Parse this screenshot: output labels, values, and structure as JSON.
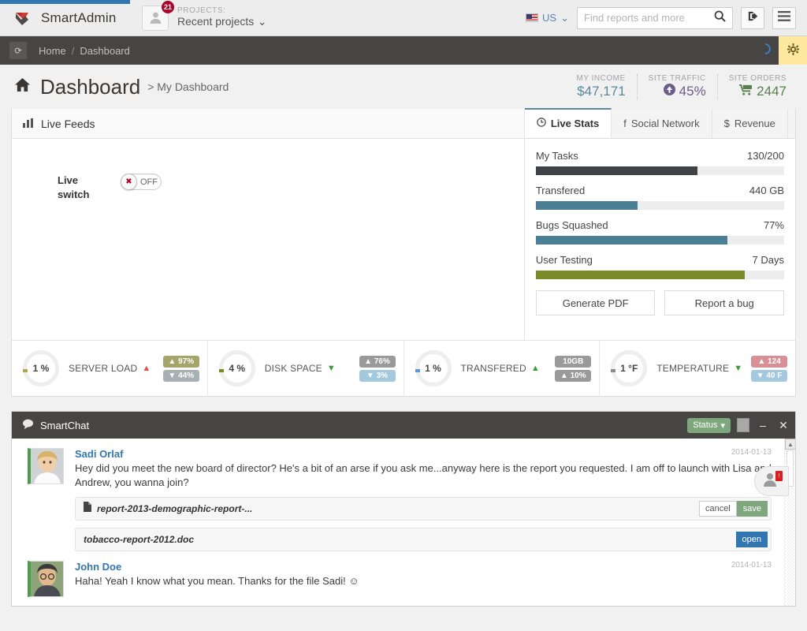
{
  "brand": {
    "name": "SmartAdmin",
    "logo_icon": "chevron-logo-icon"
  },
  "header": {
    "projects_label": "PROJECTS:",
    "projects_value": "Recent projects",
    "projects_badge": "21",
    "avatar_icon": "user-icon",
    "caret_icon": "chevron-down-icon",
    "language": "US",
    "flag_icon": "us-flag-icon",
    "search_placeholder": "Find reports and more",
    "search_value": "",
    "search_icon": "search-icon",
    "logout_icon": "logout-icon",
    "menu_icon": "hamburger-menu-icon"
  },
  "ribbon": {
    "refresh_icon": "refresh-icon",
    "crumbs": [
      "Home",
      "Dashboard"
    ],
    "separator": "/",
    "spinner_icon": "loading-spinner-icon",
    "gear_icon": "gear-icon"
  },
  "page": {
    "home_icon": "home-icon",
    "title": "Dashboard",
    "subtitle": "> My Dashboard",
    "kpis": [
      {
        "label": "MY INCOME",
        "value": "$47,171",
        "icon": "",
        "color": "#57889c"
      },
      {
        "label": "SITE TRAFFIC",
        "value": "45%",
        "icon": "arrow-up-circle-icon",
        "color": "#6a5d8a"
      },
      {
        "label": "SITE ORDERS",
        "value": "2447",
        "icon": "shopping-cart-icon",
        "color": "#5b7e52"
      }
    ]
  },
  "live_feeds": {
    "title": "Live Feeds",
    "title_icon": "bar-chart-icon",
    "switch_label": "Live switch",
    "switch_state": "OFF",
    "switch_knob_icon": "close-x-icon"
  },
  "right_panel": {
    "tabs": [
      {
        "label": "Live Stats",
        "icon": "clock-icon",
        "active": true
      },
      {
        "label": "Social Network",
        "icon": "facebook-icon",
        "active": false
      },
      {
        "label": "Revenue",
        "icon": "dollar-icon",
        "active": false
      }
    ],
    "stats": [
      {
        "label": "My Tasks",
        "value": "130/200",
        "percent": 65,
        "color": "#3e4347"
      },
      {
        "label": "Transfered",
        "value": "440 GB",
        "percent": 41,
        "color": "#4a7f96"
      },
      {
        "label": "Bugs Squashed",
        "value": "77%",
        "percent": 77,
        "color": "#4a7f96"
      },
      {
        "label": "User Testing",
        "value": "7 Days",
        "percent": 84,
        "color": "#7a8b28"
      }
    ],
    "buttons": [
      {
        "label": "Generate PDF"
      },
      {
        "label": "Report a bug"
      }
    ]
  },
  "strip": [
    {
      "ring_value": "1 %",
      "tick_color": "#b5a642",
      "name": "SERVER LOAD",
      "arrow": "up",
      "arrow_color": "#d9534f",
      "pills": [
        {
          "text": "97%",
          "dir": "up",
          "bg": "#a5a569"
        },
        {
          "text": "44%",
          "dir": "down",
          "bg": "#a7b1b3"
        }
      ]
    },
    {
      "ring_value": "4 %",
      "tick_color": "#7a8b28",
      "name": "DISK SPACE",
      "arrow": "down",
      "arrow_color": "#3c9a3c",
      "pills": [
        {
          "text": "76%",
          "dir": "up",
          "bg": "#9a9a9a"
        },
        {
          "text": "3%",
          "dir": "down",
          "bg": "#a4c8dd"
        }
      ]
    },
    {
      "ring_value": "1 %",
      "tick_color": "#5b9bd5",
      "name": "TRANSFERED",
      "arrow": "up",
      "arrow_color": "#3c9a3c",
      "pills": [
        {
          "text": "10GB",
          "dir": "none",
          "bg": "#9a9a9a"
        },
        {
          "text": "10%",
          "dir": "up",
          "bg": "#9a9a9a"
        }
      ]
    },
    {
      "ring_value": "1 °F",
      "tick_color": "#8a8a8a",
      "name": "TEMPERATURE",
      "arrow": "down",
      "arrow_color": "#3c9a3c",
      "pills": [
        {
          "text": "124",
          "dir": "up",
          "bg": "#d98f96"
        },
        {
          "text": "40 F",
          "dir": "down",
          "bg": "#a4c8dd"
        }
      ]
    }
  ],
  "chat": {
    "title": "SmartChat",
    "title_icon": "chat-bubble-icon",
    "status_label": "Status",
    "status_caret": "caret-down-icon",
    "restore_icon": "restore-window-icon",
    "minimize_icon": "minimize-icon",
    "close_icon": "close-icon",
    "scroll_up_icon": "scroll-up-arrow-icon",
    "fab_icon": "user-chat-icon",
    "fab_badge": "!",
    "messages": [
      {
        "name": "Sadi Orlaf",
        "date": "2014-01-13",
        "text": "Hey did you meet the new board of director? He's a bit of an arse if you ask me...anyway here is the report you requested. I am off to launch with Lisa and Andrew, you wanna join?",
        "attachments": [
          {
            "filename": "report-2013-demographic-report-...",
            "file_icon": "file-icon",
            "buttons": [
              {
                "label": "cancel",
                "style": "cancel"
              },
              {
                "label": "save",
                "style": "save"
              }
            ]
          },
          {
            "filename": "tobacco-report-2012.doc",
            "file_icon": "",
            "buttons": [
              {
                "label": "open",
                "style": "open"
              }
            ]
          }
        ]
      },
      {
        "name": "John Doe",
        "date": "2014-01-13",
        "text": "Haha! Yeah I know what you mean. Thanks for the file Sadi! ☺",
        "attachments": []
      }
    ]
  }
}
